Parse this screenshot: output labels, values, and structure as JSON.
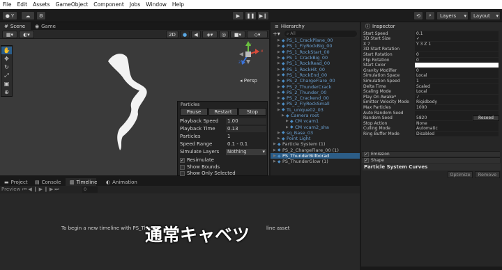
{
  "menu": [
    "File",
    "Edit",
    "Assets",
    "GameObject",
    "Component",
    "Jobs",
    "Window",
    "Help"
  ],
  "toolbar": {
    "account": "Y",
    "layers": "Layers",
    "layout": "Layout"
  },
  "scene": {
    "tabs": [
      "Scene",
      "Game"
    ],
    "mode_2d": "2D",
    "persp_label": "Persp",
    "axis_x": "x",
    "axis_y": "y",
    "axis_z": "z"
  },
  "particles": {
    "title": "Particles",
    "buttons": [
      "Pause",
      "Restart",
      "Stop"
    ],
    "rows": [
      {
        "label": "Playback Speed",
        "value": "1.00"
      },
      {
        "label": "Playback Time",
        "value": "0.13"
      },
      {
        "label": "Particles",
        "value": "1"
      },
      {
        "label": "Speed Range",
        "value": "0.1 - 0.1"
      },
      {
        "label": "Simulate Layers",
        "value": "Nothing"
      }
    ],
    "checks": [
      {
        "label": "Resimulate",
        "checked": true
      },
      {
        "label": "Show Bounds",
        "checked": false
      },
      {
        "label": "Show Only Selected",
        "checked": false
      }
    ]
  },
  "hierarchy": {
    "title": "Hierarchy",
    "search_placeholder": "All",
    "items": [
      {
        "name": "PS_1_CrackPlane_00",
        "depth": 1
      },
      {
        "name": "PS_1_FlyRockBig_00",
        "depth": 1
      },
      {
        "name": "PS_1_RockStart_00",
        "depth": 1
      },
      {
        "name": "PS_1_CrackBig_00",
        "depth": 1
      },
      {
        "name": "PS_1_RockRead_00",
        "depth": 1
      },
      {
        "name": "PS_1_RockHit_00",
        "depth": 1
      },
      {
        "name": "PS_1_RockEnd_00",
        "depth": 1
      },
      {
        "name": "PS_2_ChargeFlare_00",
        "depth": 1
      },
      {
        "name": "PS_2_ThunderCrack",
        "depth": 1
      },
      {
        "name": "PS_2_Thunder_00",
        "depth": 1
      },
      {
        "name": "PS_2_Crackend_00",
        "depth": 1
      },
      {
        "name": "PS_2_FlyRockSmall",
        "depth": 1
      },
      {
        "name": "TL_unique02_03",
        "depth": 1
      },
      {
        "name": "Camera root",
        "depth": 2
      },
      {
        "name": "CM vcam1",
        "depth": 3
      },
      {
        "name": "CM vcam2_sha",
        "depth": 3
      },
      {
        "name": "sq_Base_03",
        "depth": 1
      },
      {
        "name": "Point Light",
        "depth": 1
      },
      {
        "name": "Particle System (1)",
        "depth": 0
      },
      {
        "name": "PS_2_ChargeFlare_00 (1)",
        "depth": 0
      },
      {
        "name": "PS_ThunderBillborad",
        "depth": 0,
        "selected": true
      },
      {
        "name": "PS_ThunderGlow (1)",
        "depth": 0
      }
    ]
  },
  "inspector": {
    "title": "Inspector",
    "rows": [
      {
        "label": "Start Speed",
        "value": "0.1"
      },
      {
        "label": "3D Start Size",
        "value": "✓"
      },
      {
        "label": "X 7",
        "value": "Y 3   Z 1"
      },
      {
        "label": "3D Start Rotation",
        "value": ""
      },
      {
        "label": "Start Rotation",
        "value": "0"
      },
      {
        "label": "Flip Rotation",
        "value": "0"
      },
      {
        "label": "Start Color",
        "value": ""
      },
      {
        "label": "Gravity Modifier",
        "value": "0"
      },
      {
        "label": "Simulation Space",
        "value": "Local"
      },
      {
        "label": "Simulation Speed",
        "value": "1"
      },
      {
        "label": "Delta Time",
        "value": "Scaled"
      },
      {
        "label": "Scaling Mode",
        "value": "Local"
      },
      {
        "label": "Play On Awake*",
        "value": "✓"
      },
      {
        "label": "Emitter Velocity Mode",
        "value": "Rigidbody"
      },
      {
        "label": "Max Particles",
        "value": "1000"
      },
      {
        "label": "Auto Random Seed",
        "value": ""
      },
      {
        "label": "Random Seed",
        "value": "5820"
      },
      {
        "label": "Stop Action",
        "value": "None"
      },
      {
        "label": "Culling Mode",
        "value": "Automatic"
      },
      {
        "label": "Ring Buffer Mode",
        "value": "Disabled"
      }
    ],
    "reseed_button": "Reseed",
    "modules": [
      "Emission",
      "Shape"
    ],
    "curves_title": "Particle System Curves",
    "optimize_button": "Optimize",
    "remove_button": "Remove"
  },
  "bottom": {
    "tabs": [
      "Project",
      "Console",
      "Timeline",
      "Animation"
    ],
    "preview_label": "Preview",
    "frame_value": "0",
    "message": "To begin a new timeline with PS_Thund",
    "message_tail": "line asset"
  },
  "subtitle": "通常キャベツ"
}
